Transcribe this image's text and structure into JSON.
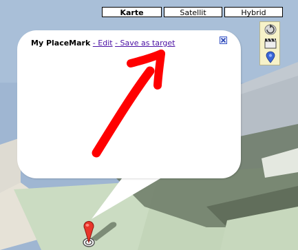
{
  "map": {
    "colors": {
      "sky": "#9fb6d2",
      "road": "#e9e4d9",
      "ground": "#c9d9bf",
      "shadow": "#6f7f68",
      "building": "#d7dcd1"
    }
  },
  "map_type_control": {
    "buttons": [
      {
        "label": "Karte",
        "active": true
      },
      {
        "label": "Satellit",
        "active": false
      },
      {
        "label": "Hybrid",
        "active": false
      }
    ]
  },
  "side_toolbar": {
    "icons": [
      "rotate-icon",
      "clapperboard-icon",
      "placemark-pin-icon"
    ]
  },
  "info_window": {
    "title": "My PlaceMark",
    "edit_link": "- Edit",
    "save_link": "- Save as target",
    "close_icon": "close-x-icon"
  },
  "annotation": {
    "arrow_color": "#ff0000"
  },
  "marker": {
    "icon": "red-placemark-pin-icon",
    "color": "#e8362b"
  }
}
